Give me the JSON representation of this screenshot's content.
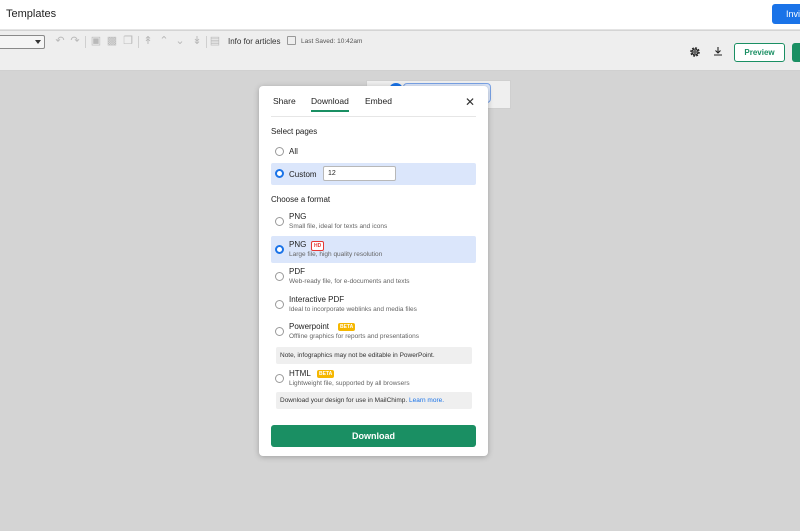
{
  "app": {
    "title": "Templates",
    "invite_label": "Invi"
  },
  "toolbar": {
    "info_label": "Info for articles",
    "last_saved": "Last Saved: 10:42am",
    "preview_label": "Preview"
  },
  "modal": {
    "tabs": [
      "Share",
      "Download",
      "Embed"
    ],
    "active_tab": "Download",
    "select_pages": {
      "title": "Select pages",
      "options": [
        {
          "label": "All",
          "selected": false
        },
        {
          "label": "Custom",
          "selected": true,
          "value": "12"
        }
      ]
    },
    "format": {
      "title": "Choose a format",
      "options": [
        {
          "label": "PNG",
          "desc": "Small file, ideal for texts and icons",
          "badge": "",
          "selected": false
        },
        {
          "label": "PNG",
          "desc": "Large file, high quality resolution",
          "badge": "HD",
          "selected": true
        },
        {
          "label": "PDF",
          "desc": "Web-ready file, for e-documents and texts",
          "badge": "",
          "selected": false
        },
        {
          "label": "Interactive PDF",
          "desc": "Ideal to incorporate weblinks and media files",
          "badge": "",
          "selected": false
        },
        {
          "label": "Powerpoint",
          "desc": "Offline graphics for reports and presentations",
          "badge": "BETA",
          "selected": false
        },
        {
          "label": "HTML",
          "desc": "Lightweight file, supported by all browsers",
          "badge": "BETA",
          "selected": false
        }
      ],
      "powerpoint_note": "Note, infographics may not be editable in PowerPoint.",
      "html_note": "Download your design for use in MailChimp.",
      "html_note_link": "Learn more."
    },
    "download_label": "Download"
  },
  "colors": {
    "accent_green": "#1a8f63",
    "accent_blue": "#1a73e8",
    "selected_bg": "#dbe6fb"
  }
}
